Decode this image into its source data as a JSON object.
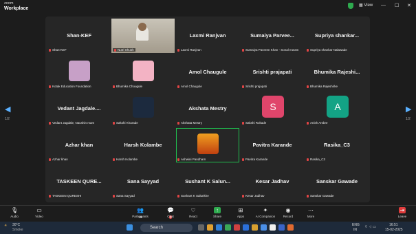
{
  "app": {
    "brand_top": "zoom",
    "brand_bottom": "Workplace",
    "view_label": "View"
  },
  "tiles": [
    {
      "name": "Shan-KEF",
      "label": "Shan-KEF"
    },
    {
      "name": "",
      "label": "Nutri Shubh"
    },
    {
      "name": "Laxmi Ranjvan",
      "label": "Laxmi Ranjvan"
    },
    {
      "name": "Sumaiya  Parvee...",
      "label": "Sumaiya Parveen Khan - Sonal ma'am"
    },
    {
      "name": "Supriya  shankar...",
      "label": "Supriya shankar Nalawade"
    },
    {
      "name": "",
      "label": "Kotak Education Foundation"
    },
    {
      "name": "",
      "label": "Bhumika Chougule"
    },
    {
      "name": "Amol Chaugule",
      "label": "Amol Chaugule"
    },
    {
      "name": "Srishti prajapati",
      "label": "Srishti prajapati"
    },
    {
      "name": "Bhumika Rajeshi...",
      "label": "Bhumika Rajeshirke"
    },
    {
      "name": "Vedant  Jagdale....",
      "label": "Vedant Jagdale, Naushin mam"
    },
    {
      "name": "",
      "label": "Sakshi Kharade"
    },
    {
      "name": "Akshata Mestry",
      "label": "Akshata Mestry"
    },
    {
      "name": "",
      "label": "Sakshi Rokade",
      "avatar": "S"
    },
    {
      "name": "",
      "label": "Anish Ambre",
      "avatar": "A"
    },
    {
      "name": "Azhar khan",
      "label": "Azhar khan"
    },
    {
      "name": "Harsh Kolambe",
      "label": "Harsh Kolambe"
    },
    {
      "name": "",
      "label": "Ashwini Pandharn"
    },
    {
      "name": "Pavitra Karande",
      "label": "Pavitra Karande"
    },
    {
      "name": "Rasika_C3",
      "label": "Rasika_C3"
    },
    {
      "name": "TASKEEN  QURE...",
      "label": "TASKEEN QURESHI"
    },
    {
      "name": "Sana Sayyad",
      "label": "Sana Sayyad"
    },
    {
      "name": "Sushant K Salun...",
      "label": "Sushant K Salunkhe"
    },
    {
      "name": "Kesar Jadhav",
      "label": "Kesar Jadhav"
    },
    {
      "name": "Sanskar Gawade",
      "label": "Sanskar Gawade"
    }
  ],
  "pager": {
    "left": "1/2",
    "right": "1/2"
  },
  "toolbar": {
    "audio": "Audio",
    "video": "Video",
    "participants": "Participants",
    "participant_count": "28",
    "chat": "Chat",
    "chat_badge": "3",
    "react": "React",
    "share": "Share",
    "apps": "Apps",
    "companion": "AI Companion",
    "record": "Record",
    "more": "More",
    "leave": "Leave"
  },
  "taskbar": {
    "weather_temp": "30°C",
    "weather_desc": "Smoke",
    "search": "Search",
    "lang1": "ENG",
    "lang2": "IN",
    "time": "16:51",
    "date": "15-02-2025"
  },
  "colors": {
    "accent_green": "#20c050",
    "avatar_s": "#e0456b",
    "avatar_a": "#13a385",
    "tile_lilac": "#c7a0c7",
    "tile_pink": "#f3b3c4"
  }
}
